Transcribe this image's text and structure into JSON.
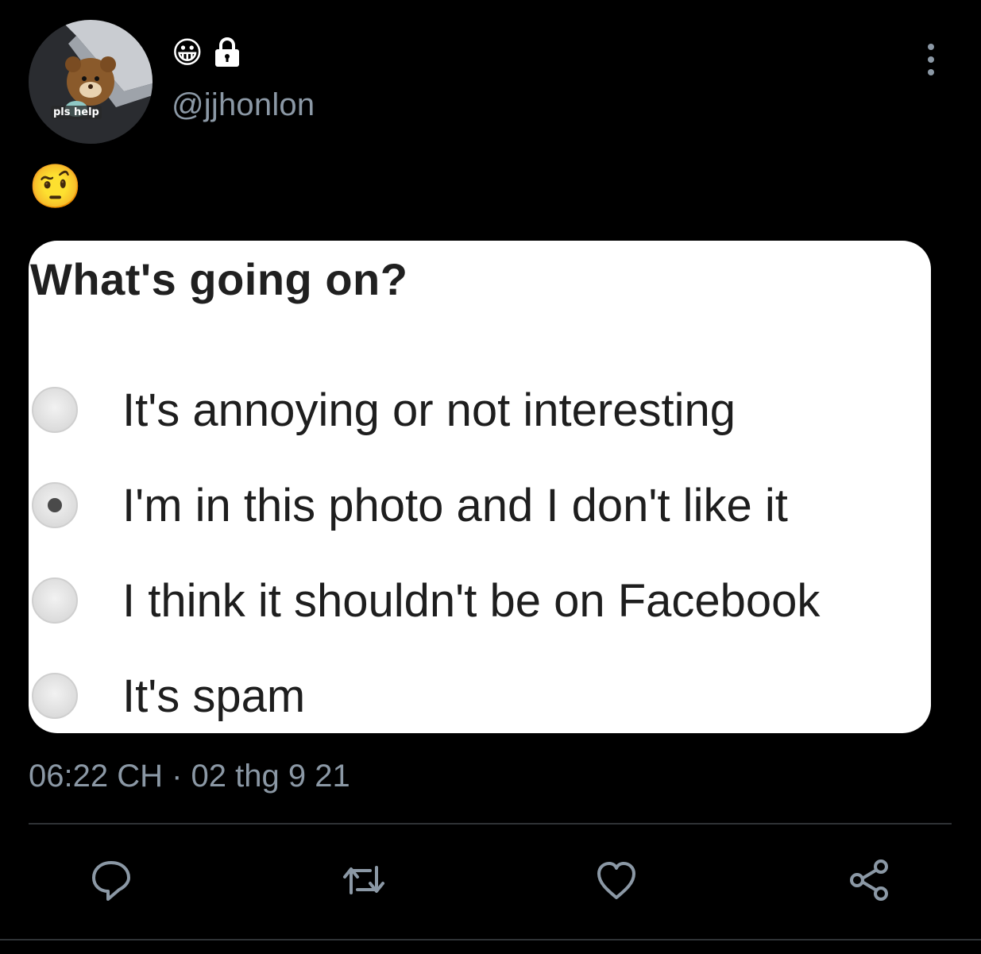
{
  "tweet": {
    "avatar": {
      "caption": "pls help",
      "icon": "teddy-bear-avatar"
    },
    "display_name_emoji": "😀",
    "protected_icon": "lock-icon",
    "handle": "@jjhonlon",
    "text": "🤨",
    "timestamp": "06:22 CH · 02 thg 9 21",
    "more_icon": "more-vertical-icon"
  },
  "media": {
    "title": "What's going on?",
    "options": [
      {
        "label": "It's annoying or not interesting",
        "selected": false
      },
      {
        "label": "I'm in this photo and I don't like it",
        "selected": true
      },
      {
        "label": "I think it shouldn't be on Facebook",
        "selected": false
      },
      {
        "label": "It's spam",
        "selected": false
      }
    ]
  },
  "actions": [
    {
      "name": "reply",
      "icon": "reply-icon"
    },
    {
      "name": "retweet",
      "icon": "retweet-icon"
    },
    {
      "name": "like",
      "icon": "heart-icon"
    },
    {
      "name": "share",
      "icon": "share-icon"
    }
  ],
  "colors": {
    "background": "#000000",
    "text": "#ffffff",
    "secondary_text": "#8b98a5",
    "divider": "#2f3336",
    "card": "#ffffff"
  }
}
